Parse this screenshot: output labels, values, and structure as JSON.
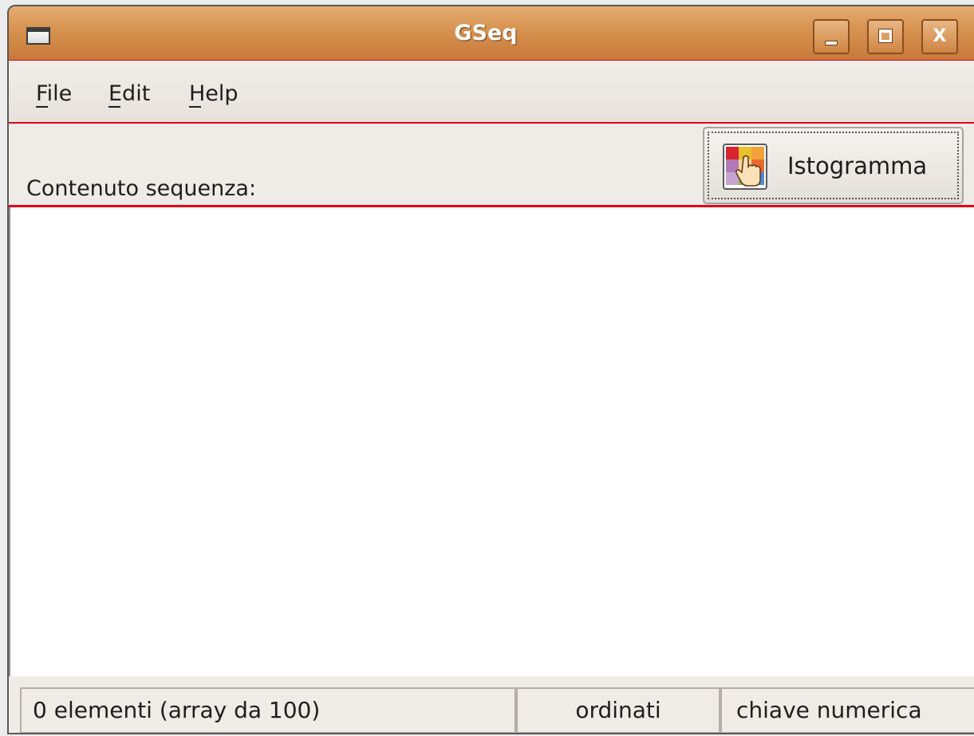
{
  "window": {
    "title": "GSeq"
  },
  "titlebar_buttons": {
    "minimize": "_",
    "maximize": "□",
    "close": "X"
  },
  "menubar": {
    "items": [
      {
        "label": "File",
        "mnemonic": "F"
      },
      {
        "label": "Edit",
        "mnemonic": "E"
      },
      {
        "label": "Help",
        "mnemonic": "H"
      }
    ]
  },
  "toolbar": {
    "sequence_label": "Contenuto sequenza:",
    "histogram_button_label": "Istogramma",
    "histogram_icon": "histogram-pointer-icon"
  },
  "content": {
    "items": []
  },
  "statusbar": {
    "count": "0 elementi (array da 100)",
    "order": "ordinati",
    "key": "chiave numerica"
  },
  "colors": {
    "titlebar": "#d6914f",
    "annotation_red": "#e2001a",
    "content_bg": "#ffffff",
    "chrome_bg": "#efebe7"
  }
}
